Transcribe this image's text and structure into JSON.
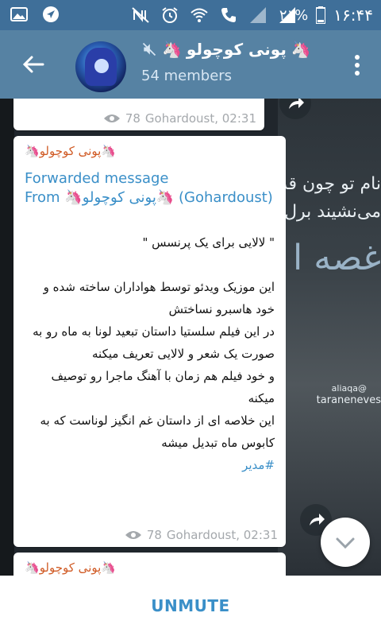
{
  "status_bar": {
    "battery": "٢١%",
    "time": "١۶:۴۴"
  },
  "header": {
    "title": "پونی کوچولو",
    "members": "54 members"
  },
  "background": {
    "line1": "نام تو چون قد",
    "line2": "می‌نشیند برل",
    "line3": "غصه ا",
    "sig": "@aliaqa",
    "sig2": "taraneneves"
  },
  "messages": {
    "top": {
      "views": "78",
      "author_time": "Gohardoust, 02:31"
    },
    "main": {
      "sender": "پونی کوچولو",
      "fwd_label": "Forwarded message",
      "fwd_from": "From",
      "fwd_channel": "پونی کوچولو",
      "fwd_author": "(Gohardoust)",
      "text": "\" لالایی برای یک پرنسس \"\n\nاین موزیک ویدئو توسط هواداران ساخته شده و خود هاسبرو نساختش\nدر این فیلم سلستیا داستان تبعید لونا به ماه رو به صورت یک شعر و لالایی تعریف میکنه\nو خود فیلم هم زمان با آهنگ ماجرا رو توصیف میکنه\nاین خلاصه ای از داستان غم انگیز لوناست که به کابوس ماه تبدیل میشه",
      "hashtag": "#مدیر",
      "views": "78",
      "author_time": "Gohardoust, 02:31"
    },
    "bottom": {
      "sender": "پونی کوچولو"
    }
  },
  "bottom_bar": {
    "unmute_label": "UNMUTE"
  }
}
